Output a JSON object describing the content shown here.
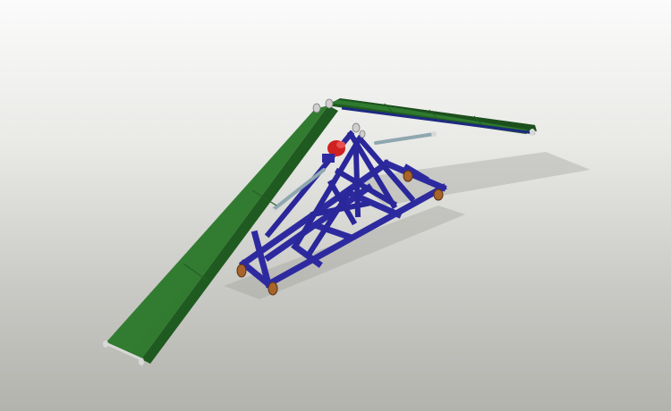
{
  "viewport": {
    "background_top": "#fbfbfb",
    "background_bottom": "#b3b3ae"
  },
  "model": {
    "colors": {
      "frame": "#2d2aa0",
      "frame_shade": "#1e1b78",
      "belt_top": "#2f7a2f",
      "belt_shade": "#1f5a20",
      "motor": "#d02020",
      "wheel": "#a8642a",
      "roller": "#d8d8d8"
    },
    "parts": [
      "lower-conveyor-belt",
      "upper-conveyor-belt",
      "a-frame-support",
      "base-frame",
      "drive-motor",
      "hydraulic-struts",
      "caster-wheels"
    ]
  }
}
